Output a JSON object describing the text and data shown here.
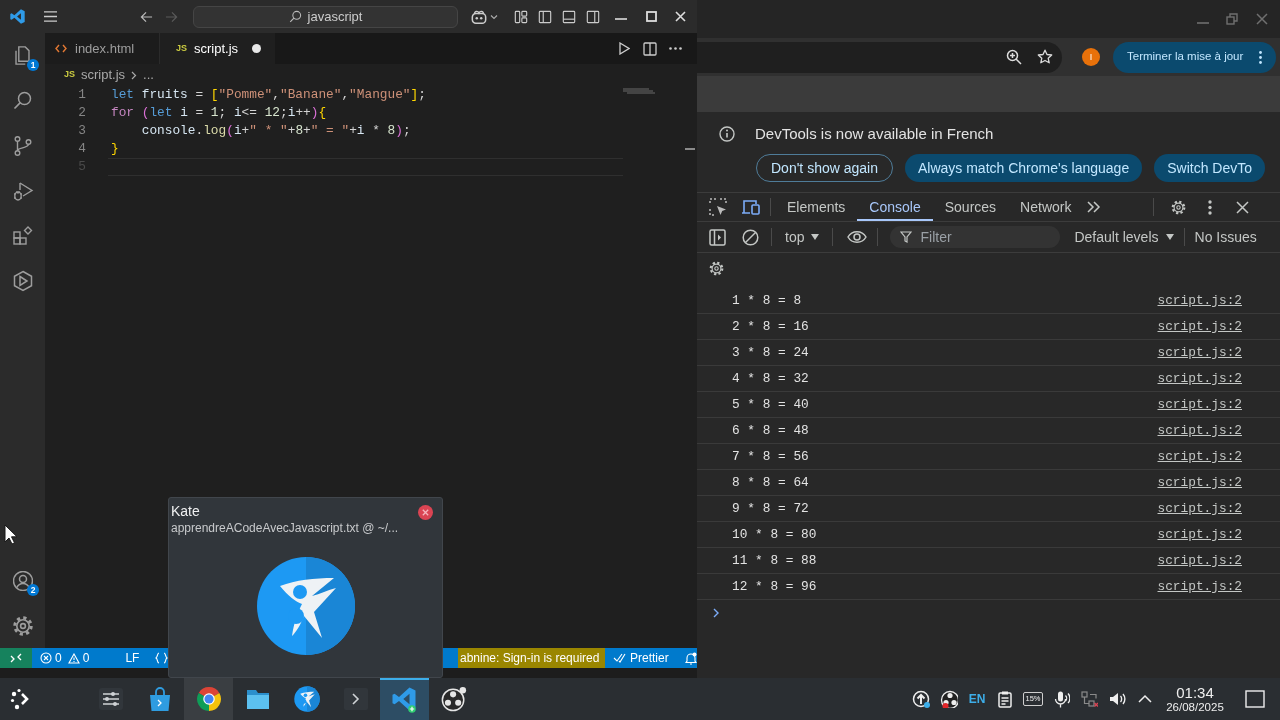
{
  "vscode": {
    "title_bar": {
      "search_label": "javascript"
    },
    "activity_bar": {
      "top": [
        {
          "kind": "explorer",
          "badge": "1"
        },
        {
          "kind": "search"
        },
        {
          "kind": "source_control"
        },
        {
          "kind": "run_debug"
        },
        {
          "kind": "extensions"
        },
        {
          "kind": "hexagon_play"
        }
      ],
      "bottom": [
        {
          "kind": "accounts",
          "badge": "2"
        },
        {
          "kind": "settings"
        }
      ]
    },
    "tabs": [
      {
        "kind": "html",
        "label": "index.html",
        "selected": false,
        "modified": false
      },
      {
        "kind": "js",
        "icon_label": "JS",
        "label": "script.js",
        "selected": true,
        "modified": true
      }
    ],
    "breadcrumb": {
      "icon_label": "JS",
      "items": [
        "script.js",
        "..."
      ]
    },
    "editor": {
      "lines": [
        {
          "number": "1",
          "current": false,
          "tokens": [
            {
              "text": "let ",
              "kind": "keyword"
            },
            {
              "text": "fruits",
              "kind": "variable"
            },
            {
              "text": " = ",
              "kind": "plain"
            },
            {
              "text": "[",
              "kind": "bracket1"
            },
            {
              "text": "\"Pomme\"",
              "kind": "string"
            },
            {
              "text": ",",
              "kind": "plain"
            },
            {
              "text": "\"Banane\"",
              "kind": "string"
            },
            {
              "text": ",",
              "kind": "plain"
            },
            {
              "text": "\"Mangue\"",
              "kind": "string"
            },
            {
              "text": "]",
              "kind": "bracket1"
            },
            {
              "text": ";",
              "kind": "plain"
            }
          ]
        },
        {
          "number": "2",
          "current": false,
          "tokens": [
            {
              "text": "for ",
              "kind": "control"
            },
            {
              "text": "(",
              "kind": "bracket2"
            },
            {
              "text": "let ",
              "kind": "keyword"
            },
            {
              "text": "i",
              "kind": "variable"
            },
            {
              "text": " = ",
              "kind": "plain"
            },
            {
              "text": "1",
              "kind": "number"
            },
            {
              "text": "; ",
              "kind": "plain"
            },
            {
              "text": "i",
              "kind": "variable"
            },
            {
              "text": "<= ",
              "kind": "plain"
            },
            {
              "text": "12",
              "kind": "number"
            },
            {
              "text": ";",
              "kind": "plain"
            },
            {
              "text": "i",
              "kind": "variable"
            },
            {
              "text": "++",
              "kind": "plain"
            },
            {
              "text": ")",
              "kind": "bracket2"
            },
            {
              "text": "{",
              "kind": "bracket1"
            }
          ]
        },
        {
          "number": "3",
          "current": false,
          "tokens": [
            {
              "text": "    console",
              "kind": "variable"
            },
            {
              "text": ".",
              "kind": "plain"
            },
            {
              "text": "log",
              "kind": "function"
            },
            {
              "text": "(",
              "kind": "bracket2"
            },
            {
              "text": "i",
              "kind": "variable"
            },
            {
              "text": "+",
              "kind": "plain"
            },
            {
              "text": "\" * \"",
              "kind": "string"
            },
            {
              "text": "+",
              "kind": "plain"
            },
            {
              "text": "8",
              "kind": "number"
            },
            {
              "text": "+",
              "kind": "plain"
            },
            {
              "text": "\" = \"",
              "kind": "string"
            },
            {
              "text": "+",
              "kind": "plain"
            },
            {
              "text": "i",
              "kind": "variable"
            },
            {
              "text": " * ",
              "kind": "plain"
            },
            {
              "text": "8",
              "kind": "number"
            },
            {
              "text": ")",
              "kind": "bracket2"
            },
            {
              "text": ";",
              "kind": "plain"
            }
          ]
        },
        {
          "number": "4",
          "current": false,
          "tokens": [
            {
              "text": "}",
              "kind": "bracket1"
            }
          ]
        },
        {
          "number": "5",
          "current": true
        }
      ]
    },
    "status_bar": {
      "errors": "0",
      "warnings": "0",
      "eol": "LF",
      "tabnine": "abnine: Sign-in is required",
      "formatter": "Prettier"
    }
  },
  "kate_popup": {
    "title": "Kate",
    "subtitle": "apprendreACodeAvecJavascript.txt @ ~/..."
  },
  "chrome": {
    "toolbar": {
      "avatar_letter": "I",
      "update_button": "Terminer la mise à jour"
    },
    "devtools": {
      "infobar": {
        "message": "DevTools is now available in French",
        "buttons": [
          {
            "label": "Don't show again",
            "kind": "outline"
          },
          {
            "label": "Always match Chrome's language",
            "kind": "filled"
          },
          {
            "label": "Switch DevTo",
            "kind": "filled"
          }
        ]
      },
      "tabs": [
        {
          "label": "Elements",
          "selected": false
        },
        {
          "label": "Console",
          "selected": true
        },
        {
          "label": "Sources",
          "selected": false
        },
        {
          "label": "Network",
          "selected": false
        }
      ],
      "console_toolbar": {
        "context": "top",
        "filter_placeholder": "Filter",
        "levels": "Default levels",
        "issues": "No Issues"
      },
      "messages": [
        {
          "text": "1 * 8 = 8",
          "source": "script.js:2"
        },
        {
          "text": "2 * 8 = 16",
          "source": "script.js:2"
        },
        {
          "text": "3 * 8 = 24",
          "source": "script.js:2"
        },
        {
          "text": "4 * 8 = 32",
          "source": "script.js:2"
        },
        {
          "text": "5 * 8 = 40",
          "source": "script.js:2"
        },
        {
          "text": "6 * 8 = 48",
          "source": "script.js:2"
        },
        {
          "text": "7 * 8 = 56",
          "source": "script.js:2"
        },
        {
          "text": "8 * 8 = 64",
          "source": "script.js:2"
        },
        {
          "text": "9 * 8 = 72",
          "source": "script.js:2"
        },
        {
          "text": "10 * 8 = 80",
          "source": "script.js:2"
        },
        {
          "text": "11 * 8 = 88",
          "source": "script.js:2"
        },
        {
          "text": "12 * 8 = 96",
          "source": "script.js:2"
        }
      ]
    }
  },
  "taskbar": {
    "apps": [
      {
        "kind": "settings",
        "focused": false,
        "highlighted": false
      },
      {
        "kind": "store",
        "focused": false,
        "highlighted": false
      },
      {
        "kind": "browser",
        "focused": false,
        "highlighted": true
      },
      {
        "kind": "files",
        "focused": false,
        "highlighted": false
      },
      {
        "kind": "kate",
        "focused": false,
        "highlighted": false
      },
      {
        "kind": "terminal",
        "focused": false,
        "highlighted": false
      },
      {
        "kind": "code",
        "focused": true,
        "highlighted": false
      },
      {
        "kind": "recorder",
        "focused": false,
        "highlighted": false
      }
    ],
    "tray": [
      {
        "kind": "updates"
      },
      {
        "kind": "recorder"
      },
      {
        "kind": "keyboard_layout",
        "label": "EN"
      },
      {
        "kind": "clipboard"
      },
      {
        "kind": "battery",
        "label": "15%"
      },
      {
        "kind": "microphone"
      },
      {
        "kind": "network"
      },
      {
        "kind": "volume"
      },
      {
        "kind": "expand"
      }
    ],
    "clock": {
      "time": "01:34",
      "date": "26/08/2025"
    }
  }
}
